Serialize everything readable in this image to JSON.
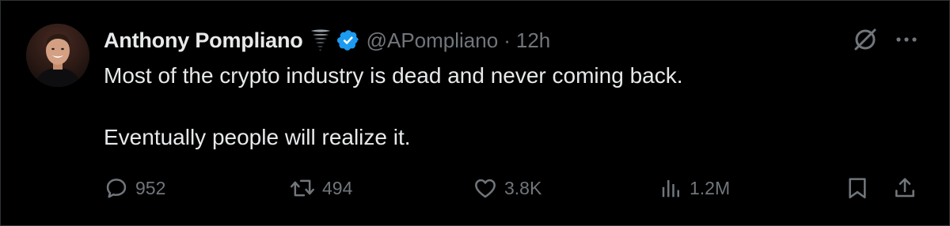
{
  "author": {
    "display_name": "Anthony Pompliano",
    "emoji_icon": "tornado-icon",
    "verified_icon": "verified-badge-icon",
    "handle": "@APompliano",
    "separator": "·",
    "time": "12h",
    "verified_color": "#1d9bf0"
  },
  "tweet": {
    "lines": [
      "Most of the crypto industry is dead and never coming back.",
      "Eventually people will realize it."
    ]
  },
  "actions": {
    "reply": {
      "icon": "reply-icon",
      "count": "952"
    },
    "retweet": {
      "icon": "retweet-icon",
      "count": "494"
    },
    "like": {
      "icon": "heart-icon",
      "count": "3.8K"
    },
    "views": {
      "icon": "views-icon",
      "count": "1.2M"
    },
    "bookmark": {
      "icon": "bookmark-icon"
    },
    "share": {
      "icon": "share-icon"
    }
  },
  "top_actions": {
    "grok": {
      "icon": "grok-icon"
    },
    "more": {
      "icon": "more-icon"
    }
  },
  "colors": {
    "background": "#000000",
    "text_primary": "#e7e9ea",
    "text_secondary": "#71767b",
    "accent": "#1d9bf0"
  }
}
